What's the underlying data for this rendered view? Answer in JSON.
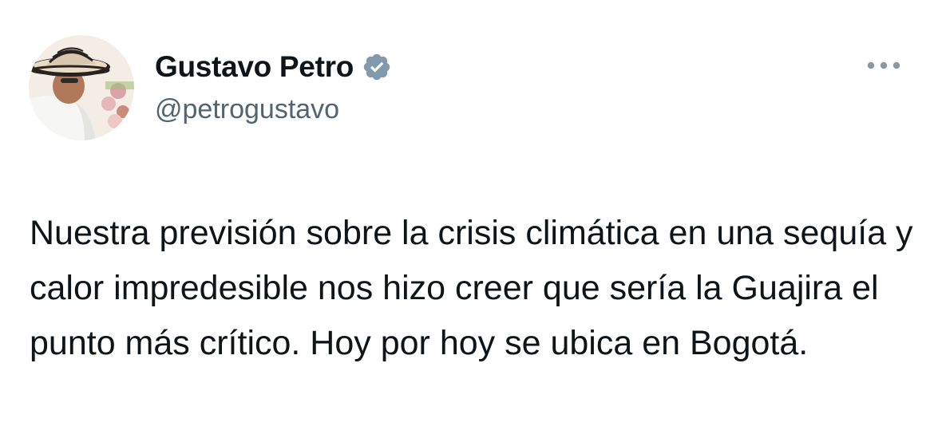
{
  "author": {
    "name": "Gustavo Petro",
    "handle": "@petrogustavo",
    "verified_color": "#829aab"
  },
  "icons": {
    "verified": "verified-badge-icon",
    "more": "more-options-icon"
  },
  "tweet": {
    "text": "Nuestra previsión sobre la crisis climática en una sequía y calor impredesible nos hizo creer que sería la Guajira el punto más crítico. Hoy por hoy se ubica en Bogotá."
  }
}
